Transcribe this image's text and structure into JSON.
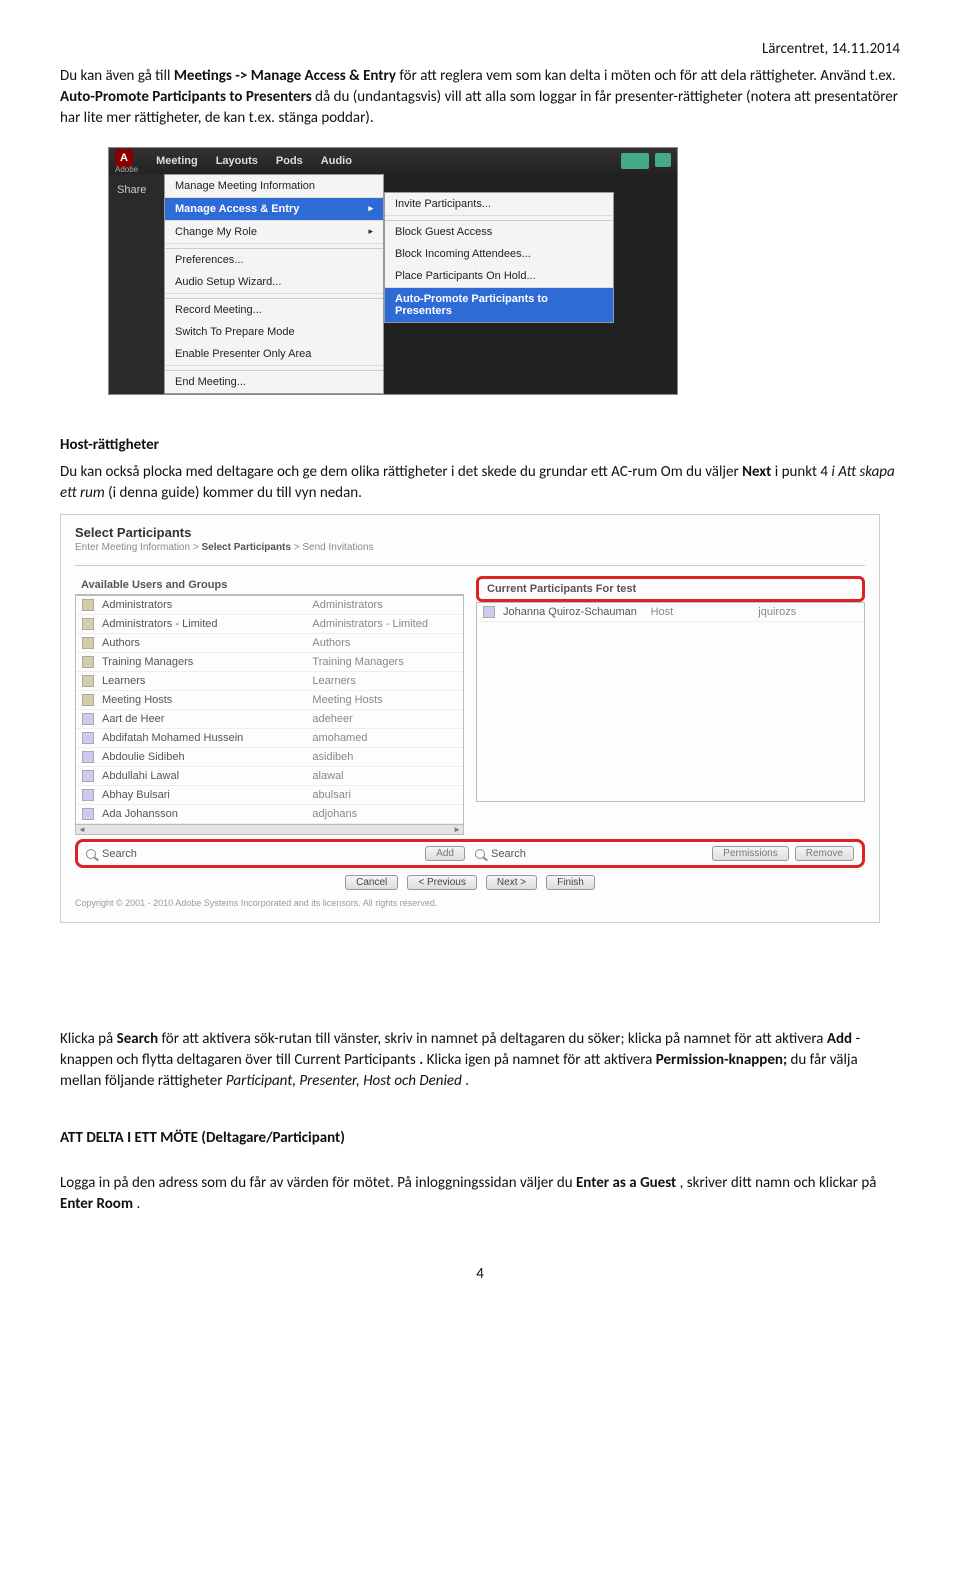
{
  "header": {
    "right": "Lärcentret, 14.11.2014"
  },
  "para1": {
    "pre": "Du kan även gå till ",
    "b1": "Meetings -> Manage Access & Entry",
    "mid1": " för att reglera vem som kan delta i möten och för att dela rättigheter. Använd t.ex. ",
    "b2": "Auto-Promote Participants to Presenters",
    "mid2": " då du (undantagsvis) vill att alla som loggar in får presenter-rättigheter (notera att presentatörer har lite mer rättigheter, de kan t.ex. stänga poddar)."
  },
  "shot1": {
    "logo": "A",
    "logosub": "Adobe",
    "menus": {
      "meeting": "Meeting",
      "layouts": "Layouts",
      "pods": "Pods",
      "audio": "Audio"
    },
    "share": "Share",
    "menu_items": {
      "mi1": "Manage Meeting Information",
      "mi2": "Manage Access & Entry",
      "mi3": "Change My Role",
      "mi4": "Preferences...",
      "mi5": "Audio Setup Wizard...",
      "mi6": "Record Meeting...",
      "mi7": "Switch To Prepare Mode",
      "mi8": "Enable Presenter Only Area",
      "mi9": "End Meeting..."
    },
    "sub_items": {
      "s1": "Invite Participants...",
      "s2": "Block Guest Access",
      "s3": "Block Incoming Attendees...",
      "s4": "Place Participants On Hold...",
      "s5": "Auto-Promote Participants to Presenters"
    }
  },
  "host_heading": "Host-rättigheter",
  "para2": {
    "t1": "Du kan också plocka med deltagare och ge dem olika rättigheter i det skede du grundar ett AC-rum Om du väljer ",
    "b1": "Next ",
    "t2": "i punkt 4 ",
    "i1": "i Att skapa ett rum",
    "t3": " (i denna guide) kommer du till vyn nedan."
  },
  "shot2": {
    "title": "Select Participants",
    "bc1": "Enter Meeting Information",
    "bc2": "Select Participants",
    "bc3": "Send Invitations",
    "left_hdr": "Available Users and Groups",
    "right_hdr": "Current Participants For test",
    "left_rows": [
      {
        "n": "Administrators",
        "r": "Administrators",
        "u": false
      },
      {
        "n": "Administrators - Limited",
        "r": "Administrators - Limited",
        "u": false
      },
      {
        "n": "Authors",
        "r": "Authors",
        "u": false
      },
      {
        "n": "Training Managers",
        "r": "Training Managers",
        "u": false
      },
      {
        "n": "Learners",
        "r": "Learners",
        "u": false
      },
      {
        "n": "Meeting Hosts",
        "r": "Meeting Hosts",
        "u": false
      },
      {
        "n": "Aart de Heer",
        "r": "adeheer",
        "u": true
      },
      {
        "n": "Abdifatah Mohamed Hussein",
        "r": "amohamed",
        "u": true
      },
      {
        "n": "Abdoulie Sidibeh",
        "r": "asidibeh",
        "u": true
      },
      {
        "n": "Abdullahi Lawal",
        "r": "alawal",
        "u": true
      },
      {
        "n": "Abhay Bulsari",
        "r": "abulsari",
        "u": true
      },
      {
        "n": "Ada Johansson",
        "r": "adjohans",
        "u": true
      }
    ],
    "right_rows": [
      {
        "n": "Johanna Quiroz-Schauman",
        "r": "Host",
        "x": "jquirozs"
      }
    ],
    "search": "Search",
    "add": "Add",
    "perm": "Permissions",
    "remove": "Remove",
    "nav": {
      "cancel": "Cancel",
      "prev": "< Previous",
      "next": "Next >",
      "finish": "Finish"
    },
    "copyright": "Copyright © 2001 - 2010 Adobe Systems Incorporated and its licensors. All rights reserved."
  },
  "para3": {
    "t1": "Klicka på ",
    "b1": "Search",
    "t2": " för att aktivera sök-rutan till vänster, skriv in namnet på deltagaren du söker; klicka på namnet för att aktivera ",
    "b2": "Add",
    "t3": "-knappen och flytta deltagaren över till Current Participants",
    "b3": ".",
    "t4": " Klicka igen på namnet för att aktivera ",
    "b4": "Permission-knappen;",
    "t5": " du får välja mellan följande rättigheter ",
    "i1": "Participant, Presenter, Host och Denied",
    "t6": "."
  },
  "para4_heading": "ATT DELTA I ETT MÖTE (Deltagare/Participant)",
  "para5": {
    "t1": "Logga in på den adress som du får av värden för mötet. På inloggningssidan väljer du ",
    "b1": "Enter as a Guest",
    "t2": ", skriver ditt namn och klickar på ",
    "b2": "Enter Room",
    "t3": "."
  },
  "pagenum": "4"
}
